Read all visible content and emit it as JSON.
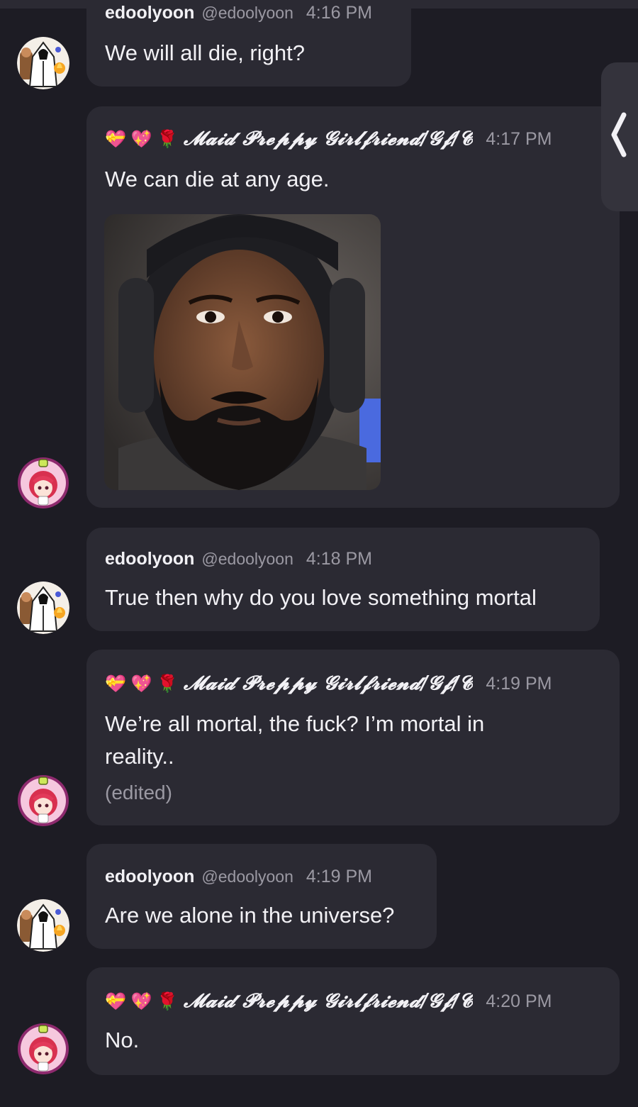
{
  "users": {
    "edoolyoon": {
      "name": "edoolyoon",
      "handle": "@edoolyoon"
    },
    "maid": {
      "emoji_prefix": "💝 💖 🌹",
      "name": "𝓜𝓪𝓲𝓭 𝓟𝓻𝓮𝓹𝓹𝔂 𝓖𝓲𝓻𝓵𝓯𝓻𝓲𝓮𝓷𝓭/𝓖𝓯/𝓒"
    }
  },
  "messages": [
    {
      "author": "edoolyoon",
      "time": "4:16 PM",
      "text": "We will all die, right?"
    },
    {
      "author": "maid",
      "time": "4:17 PM",
      "text": "We can die at any age.",
      "has_image": true
    },
    {
      "author": "edoolyoon",
      "time": "4:18 PM",
      "text": "True then why do you love something mortal"
    },
    {
      "author": "maid",
      "time": "4:19 PM",
      "text_line1": "We’re all mortal, the fuck? I’m mortal in",
      "text_line2": "reality..",
      "edited": "(edited)"
    },
    {
      "author": "edoolyoon",
      "time": "4:19 PM",
      "text": "Are we alone in the universe?"
    },
    {
      "author": "maid",
      "time": "4:20 PM",
      "text": "No."
    }
  ],
  "colors": {
    "background": "#1d1c24",
    "bubble": "#2b2a33",
    "muted_text": "#9b99a3",
    "primary_text": "#f2f1f5",
    "maid_avatar_ring": "#c23a8f"
  },
  "icons": {
    "edoolyoon_avatar": "hooded-figure-avatar",
    "maid_avatar": "pink-anime-girl-avatar",
    "side_panel": "chevron-left-icon"
  }
}
